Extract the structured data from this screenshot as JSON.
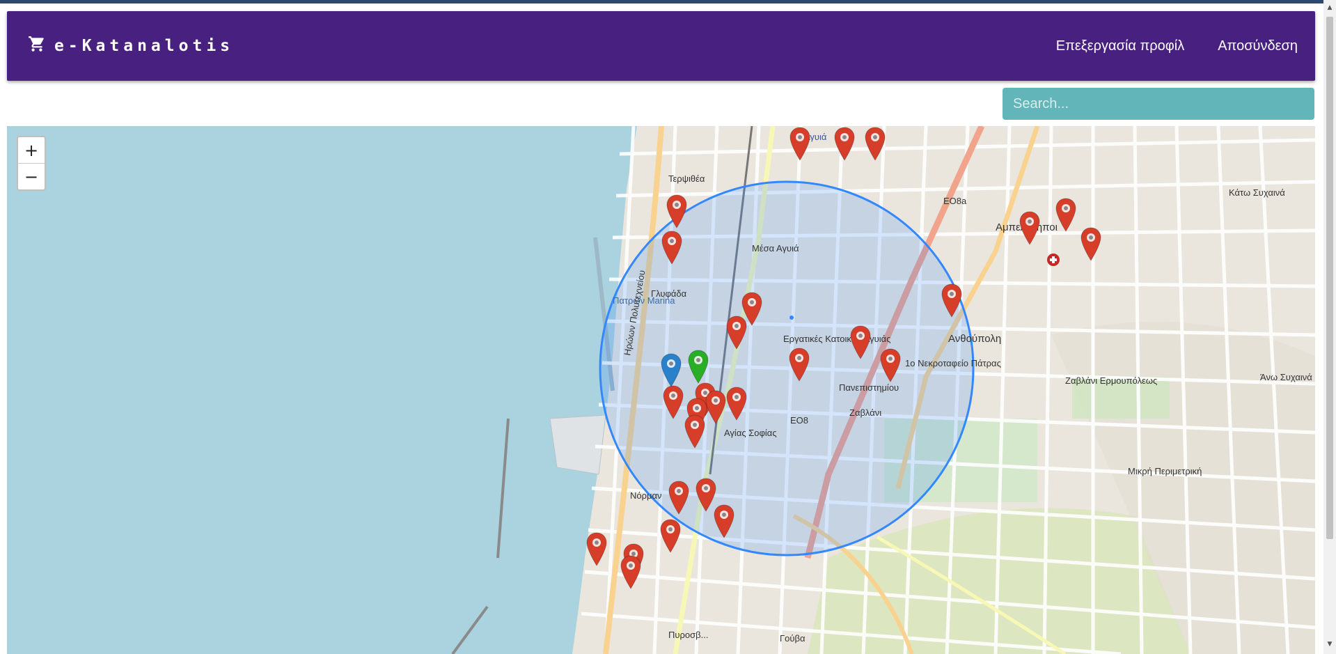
{
  "app": {
    "name": "e-Katanalotis"
  },
  "colors": {
    "navbar": "#48207f",
    "navbar_text": "#ffffff",
    "search_bg": "#62b6b9",
    "sea": "#aad3df",
    "radius_circle": "#3388ff",
    "marker_red": "#d63e2a",
    "marker_blue": "#2a81cb",
    "marker_green": "#2aad27"
  },
  "header": {
    "cart_icon": "shopping-cart-icon",
    "links": [
      {
        "label": "Επεξεργασία προφίλ"
      },
      {
        "label": "Αποσύνδεση"
      }
    ]
  },
  "search": {
    "placeholder": "Search...",
    "value": ""
  },
  "map": {
    "zoom_in_label": "+",
    "zoom_out_label": "−",
    "labels": [
      "Αγυιά",
      "Τερψιθέα",
      "Μέσα Αγυιά",
      "Γλυφάδα",
      "Εργατικές Κατοικίες Αγυιάς",
      "Αμπελόκηποι",
      "Ανθούπολη",
      "Ζαβλάνι",
      "Ζαβλάνι Ερμουπόλεως",
      "Γούβα",
      "Κάτω Συχαινά",
      "Άνω Συχαινά",
      "Αγίας Σοφίας",
      "ΕΟ8",
      "ΕΟ8a",
      "Πανεπιστημίου",
      "Μικρή Περιμετρική",
      "1ο Νεκροταφείο Πάτρας",
      "Πατρών Marina",
      "Ηρώων Πολυτεχνείου",
      "Νόρμαν",
      "Πυροσβ..."
    ],
    "markers": {
      "user_location_color": "blue",
      "highlighted_store_color": "green",
      "red_store_count": 27
    }
  }
}
